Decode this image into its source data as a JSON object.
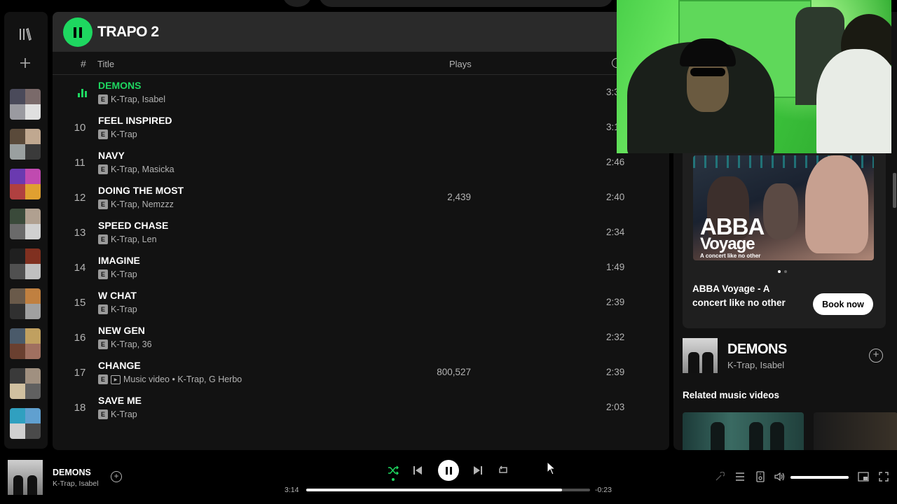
{
  "playlist": {
    "title": "TRAPO 2",
    "columns": {
      "number": "#",
      "title": "Title",
      "plays": "Plays"
    },
    "tracks": [
      {
        "number": "",
        "title": "DEMONS",
        "artists": "K-Trap, Isabel",
        "plays": "",
        "duration": "3:3",
        "active": true,
        "video": false
      },
      {
        "number": "10",
        "title": "FEEL INSPIRED",
        "artists": "K-Trap",
        "plays": "",
        "duration": "3:1",
        "active": false,
        "video": false
      },
      {
        "number": "11",
        "title": "NAVY",
        "artists": "K-Trap, Masicka",
        "plays": "",
        "duration": "2:46",
        "active": false,
        "video": false
      },
      {
        "number": "12",
        "title": "DOING THE MOST",
        "artists": "K-Trap, Nemzzz",
        "plays": "2,439",
        "duration": "2:40",
        "active": false,
        "video": false
      },
      {
        "number": "13",
        "title": "SPEED CHASE",
        "artists": "K-Trap, Len",
        "plays": "",
        "duration": "2:34",
        "active": false,
        "video": false
      },
      {
        "number": "14",
        "title": "IMAGINE",
        "artists": "K-Trap",
        "plays": "",
        "duration": "1:49",
        "active": false,
        "video": false
      },
      {
        "number": "15",
        "title": "W CHAT",
        "artists": "K-Trap",
        "plays": "",
        "duration": "2:39",
        "active": false,
        "video": false
      },
      {
        "number": "16",
        "title": "NEW GEN",
        "artists": "K-Trap, 36",
        "plays": "",
        "duration": "2:32",
        "active": false,
        "video": false
      },
      {
        "number": "17",
        "title": "CHANGE",
        "artists": "Music video • K-Trap, G Herbo",
        "plays": "800,527",
        "duration": "2:39",
        "active": false,
        "video": true
      },
      {
        "number": "18",
        "title": "SAVE ME",
        "artists": "K-Trap",
        "plays": "",
        "duration": "2:03",
        "active": false,
        "video": false
      }
    ],
    "explicit_badge": "E"
  },
  "right_panel": {
    "ad": {
      "logo_line1": "ABBA",
      "logo_line2": "Voyage",
      "logo_sub": "A concert like no other",
      "title": "ABBA Voyage - A concert like no other",
      "button": "Book now"
    },
    "now_playing": {
      "title": "DEMONS",
      "artists": "K-Trap, Isabel"
    },
    "related_title": "Related music videos"
  },
  "player": {
    "track": "DEMONS",
    "artists": "K-Trap, Isabel",
    "time_current": "3:14",
    "time_remaining": "-0:23",
    "progress": 0.9,
    "volume": 1.0
  },
  "colors": {
    "accent": "#1ed760",
    "panel": "#121212",
    "header": "#2a2a2a",
    "subtext": "#b3b3b3"
  },
  "icons": [
    "library-icon",
    "plus-icon",
    "pause-icon",
    "clock-icon",
    "equalizer-icon",
    "explicit-icon",
    "video-icon",
    "add-circle-icon",
    "shuffle-icon",
    "previous-icon",
    "next-icon",
    "repeat-icon",
    "lyrics-icon",
    "queue-icon",
    "device-icon",
    "volume-icon",
    "miniplayer-icon",
    "fullscreen-icon"
  ]
}
